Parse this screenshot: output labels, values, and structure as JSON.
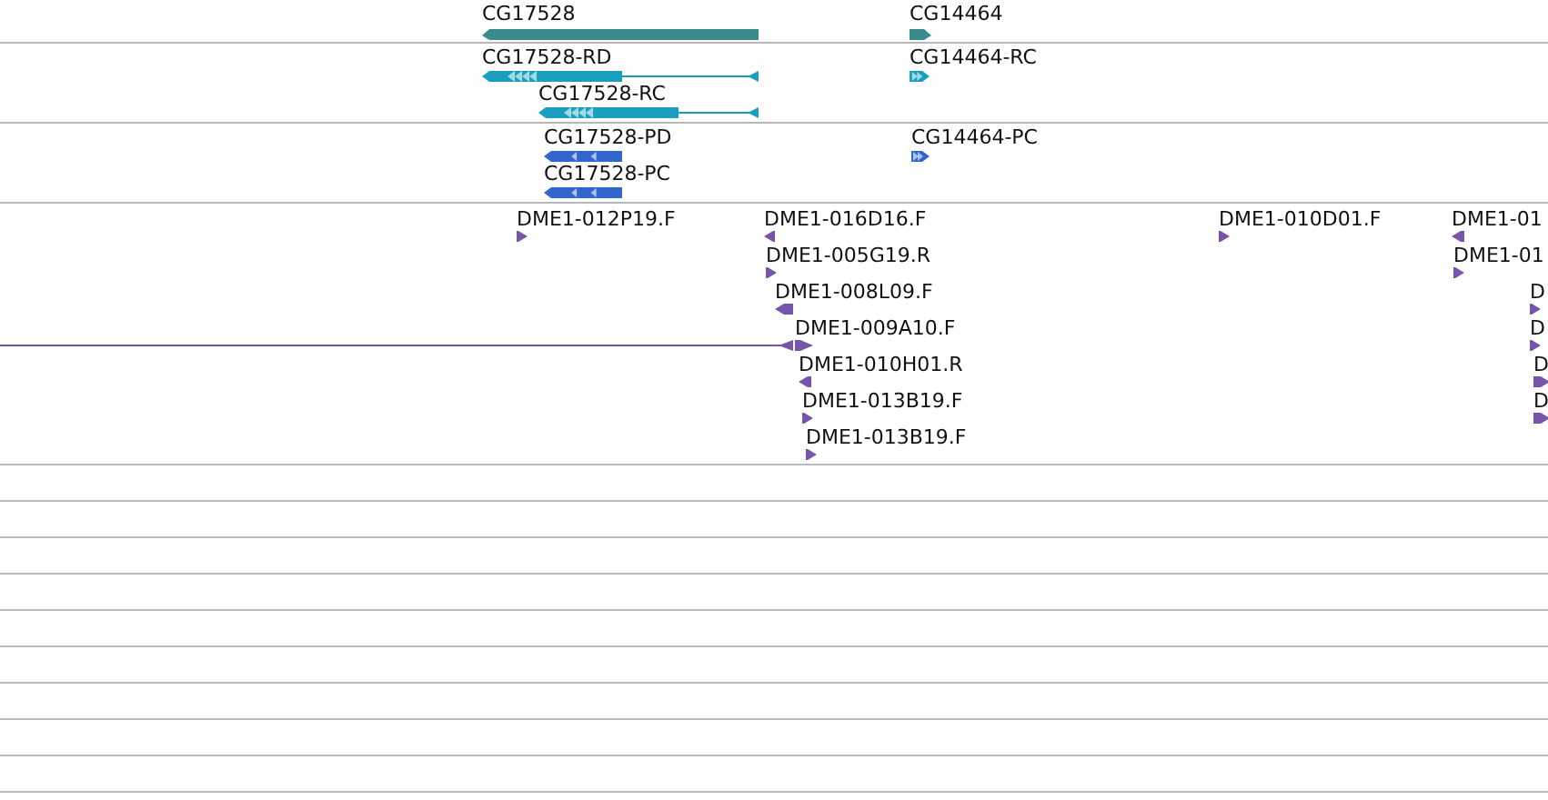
{
  "tracks": [
    {
      "color": "#3a8c8c",
      "features": [
        {
          "label": "CG17528",
          "kind": "gene",
          "reverse": true
        },
        {
          "label": "CG14464",
          "kind": "gene",
          "reverse": false
        }
      ]
    },
    {
      "color": "#1a9fbf",
      "features": [
        {
          "label": "CG17528-RD",
          "kind": "transcript",
          "reverse": true
        },
        {
          "label": "CG17528-RC",
          "kind": "transcript",
          "reverse": true
        },
        {
          "label": "CG14464-RC",
          "kind": "exons",
          "reverse": false
        }
      ]
    },
    {
      "color": "#3366cc",
      "features": [
        {
          "label": "CG17528-PD",
          "kind": "exons",
          "reverse": true
        },
        {
          "label": "CG17528-PC",
          "kind": "exons",
          "reverse": true
        },
        {
          "label": "CG14464-PC",
          "kind": "exons",
          "reverse": false
        }
      ]
    },
    {
      "color": "#7755aa",
      "features": [
        {
          "label": "DME1-012P19.F",
          "kind": "read",
          "reverse": false
        },
        {
          "label": "DME1-016D16.F",
          "kind": "read",
          "reverse": true
        },
        {
          "label": "DME1-005G19.R",
          "kind": "read",
          "reverse": false
        },
        {
          "label": "DME1-008L09.F",
          "kind": "read",
          "reverse": true
        },
        {
          "label": "DME1-009A10.F",
          "kind": "pair",
          "reverse": false
        },
        {
          "label": "DME1-010H01.R",
          "kind": "read",
          "reverse": true
        },
        {
          "label": "DME1-013B19.F",
          "kind": "read",
          "reverse": false
        },
        {
          "label": "DME1-013B19.F",
          "kind": "read",
          "reverse": false
        },
        {
          "label": "DME1-010D01.F",
          "kind": "read",
          "reverse": false
        },
        {
          "label": "DME1-01",
          "kind": "read",
          "reverse": true
        },
        {
          "label": "DME1-01",
          "kind": "read",
          "reverse": false
        },
        {
          "label": "D",
          "kind": "read",
          "reverse": false
        },
        {
          "label": "D",
          "kind": "read",
          "reverse": false
        },
        {
          "label": "D",
          "kind": "read",
          "reverse": false
        },
        {
          "label": "D",
          "kind": "read",
          "reverse": false
        }
      ]
    }
  ]
}
